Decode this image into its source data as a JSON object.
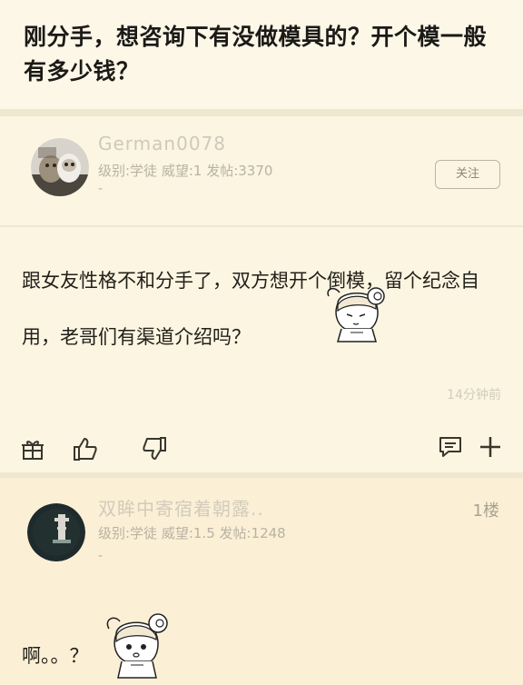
{
  "thread": {
    "title": "刚分手，想咨询下有没做模具的？开个模一般有多少钱？"
  },
  "post1": {
    "username": "German0078",
    "meta": "级别:学徒 威望:1 发帖:3370",
    "follow_label": "关注",
    "content": "跟女友性格不和分手了，双方想开个倒模，留个纪念自用，老哥们有渠道介绍吗？",
    "time": "14分钟前",
    "icons": [
      "gift-icon",
      "thumb-up-icon",
      "thumb-down-icon",
      "comment-icon",
      "plus-icon"
    ]
  },
  "post2": {
    "username": "双眸中寄宿着朝露..",
    "meta": "级别:学徒 威望:1.5 发帖:1248",
    "floor": "1楼",
    "content": "啊。。？"
  }
}
